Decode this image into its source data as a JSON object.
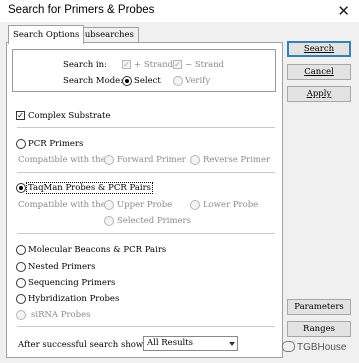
{
  "window": {
    "title": "Search for Primers & Probes",
    "close_glyph": "✕"
  },
  "tabs": [
    {
      "label": "Search Options"
    },
    {
      "label": "Subsearches"
    }
  ],
  "search_in": {
    "label": "Search in:",
    "plus_strand": {
      "label": "+ Strand",
      "checked": true,
      "enabled": false
    },
    "minus_strand": {
      "label": "− Strand",
      "checked": true,
      "enabled": false
    }
  },
  "search_mode": {
    "label": "Search Mode:",
    "select": {
      "label": "Select",
      "selected": true
    },
    "verify": {
      "label": "Verify",
      "selected": false,
      "enabled": false
    }
  },
  "complex_substrate": {
    "label": "Complex Substrate",
    "checked": true
  },
  "pcr_primers": {
    "label": "PCR Primers",
    "selected": false,
    "compat_label": "Compatible with the",
    "forward": {
      "label": "Forward Primer"
    },
    "reverse": {
      "label": "Reverse Primer"
    }
  },
  "taqman": {
    "label": "TaqMan Probes & PCR Pairs",
    "selected": true,
    "compat_label": "Compatible with the",
    "upper": {
      "label": "Upper Probe"
    },
    "lower": {
      "label": "Lower Probe"
    },
    "selected_primers": {
      "label": "Selected Primers"
    }
  },
  "other_types": [
    {
      "label": "Molecular Beacons & PCR Pairs",
      "enabled": true
    },
    {
      "label": "Nested Primers",
      "enabled": true
    },
    {
      "label": "Sequencing Primers",
      "enabled": true
    },
    {
      "label": "Hybridization Probes",
      "enabled": true
    },
    {
      "label": "siRNA Probes",
      "enabled": false
    }
  ],
  "after_search": {
    "label": "After successful search show:",
    "value": "All Results"
  },
  "buttons": {
    "search": "Search",
    "cancel": "Cancel",
    "apply": "Apply",
    "parameters": "Parameters",
    "ranges": "Ranges"
  },
  "watermark": "TGBHouse"
}
